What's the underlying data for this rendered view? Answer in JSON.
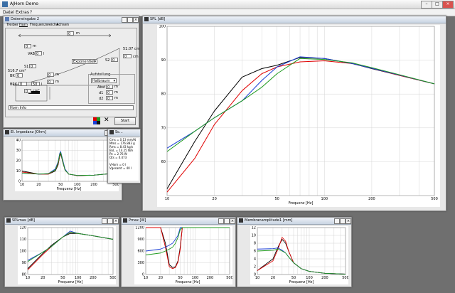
{
  "app": {
    "title": "AJHorn Demo"
  },
  "menu": {
    "items": [
      "Datei",
      "Extras",
      "?"
    ]
  },
  "colors": {
    "black": "#000000",
    "red": "#e00000",
    "blue": "#1a3ed6",
    "green": "#1f9a1f"
  },
  "input_window": {
    "title": "Dateneingabe 2",
    "tabs": [
      "Treiber",
      "Horn",
      "Frequenzweiche",
      "Achsen"
    ],
    "fields": {
      "length": "0",
      "vab": "0",
      "st": "0",
      "s2": "0",
      "s1": "0",
      "bk": "0",
      "x": "0",
      "y": "0",
      "brk": "0",
      "w": "50",
      "z": "0",
      "r1": "0",
      "r2": "0",
      "abst": "0",
      "d1": "0",
      "d2": "0"
    },
    "units": {
      "m": "m",
      "l": "l",
      "cm": "cm",
      "cm2": "cm²"
    },
    "labels": {
      "vab": "VAB",
      "s1": "S1",
      "s2": "S2",
      "bk": "BK",
      "brk": "BRK",
      "length_val": "51.07 cm",
      "area_val": "516.7 cm²",
      "aufstellung": "Aufstellung",
      "abst": "Abst",
      "d1": "d1",
      "d2": "d2",
      "horninfo": "Horn Info"
    },
    "horn_type": "Exponentiell",
    "placement": "Halbraum",
    "start_label": "Start"
  },
  "impedance_window": {
    "title": "El. Impedanz [Ohm]",
    "x_label": "Frequenz [Hz]",
    "x_ticks": [
      "10",
      "20",
      "50",
      "100",
      "200",
      "500"
    ],
    "y_ticks": [
      "40",
      "30",
      "20",
      "10",
      "0"
    ]
  },
  "params_window": {
    "title": "Sc...",
    "lines": [
      "Cms = 0.13 mm/N",
      "Mms = 176.883 g",
      "Rms = 8.43 kg/s",
      "BxL = 14.25 N/A",
      "Pe = 2.76 W",
      "Qts = 0.473",
      "",
      "VHorn = 0 l",
      "Vgesamt = 40 l"
    ]
  },
  "spl_window": {
    "title": "SPL [dB]",
    "x_label": "Frequenz [Hz]",
    "x_ticks": [
      "10",
      "20",
      "50",
      "100",
      "200",
      "500"
    ],
    "y_ticks": [
      "100",
      "90",
      "80",
      "70",
      "60"
    ]
  },
  "splmax_window": {
    "title": "SPLmax [dB]",
    "x_label": "Frequenz [Hz]",
    "x_ticks": [
      "10",
      "20",
      "50",
      "100",
      "200",
      "500"
    ],
    "y_ticks": [
      "120",
      "110",
      "100",
      "90",
      "80"
    ]
  },
  "pmax_window": {
    "title": "Pmax [W]",
    "x_label": "Frequenz [Hz]",
    "x_ticks": [
      "10",
      "20",
      "50",
      "100",
      "200",
      "500"
    ],
    "y_ticks": [
      "1200",
      "900",
      "600",
      "300",
      "0"
    ]
  },
  "membrane_window": {
    "title": "Membranamplitude1 [mm]",
    "x_label": "Frequenz [Hz]",
    "x_ticks": [
      "10",
      "20",
      "50",
      "100",
      "200",
      "500"
    ],
    "y_ticks": [
      "12",
      "10",
      "8",
      "6",
      "4",
      "2",
      "0"
    ]
  },
  "chart_data": [
    {
      "type": "line",
      "title": "SPL [dB]",
      "xlabel": "Frequenz [Hz]",
      "xscale": "log",
      "xlim": [
        10,
        500
      ],
      "ylim": [
        50,
        100
      ],
      "series": [
        {
          "color": "#000000",
          "x": [
            10,
            15,
            20,
            30,
            40,
            50,
            70,
            100,
            150,
            200,
            300,
            500
          ],
          "y": [
            52,
            66,
            75,
            85,
            87.5,
            88.5,
            90.8,
            90.5,
            89,
            87.5,
            85.5,
            83
          ]
        },
        {
          "color": "#e00000",
          "x": [
            10,
            15,
            20,
            30,
            40,
            50,
            70,
            100,
            150,
            200,
            300,
            500
          ],
          "y": [
            51,
            61,
            71,
            81,
            86,
            88,
            89.5,
            89.8,
            89,
            87.6,
            85.5,
            83
          ]
        },
        {
          "color": "#1a3ed6",
          "x": [
            10,
            15,
            20,
            30,
            40,
            50,
            70,
            100,
            150,
            200,
            300,
            500
          ],
          "y": [
            64,
            69,
            73,
            78,
            84,
            88,
            91,
            90.5,
            89,
            87.6,
            85.6,
            83
          ]
        },
        {
          "color": "#1f9a1f",
          "x": [
            10,
            15,
            20,
            30,
            40,
            50,
            70,
            100,
            150,
            200,
            300,
            500
          ],
          "y": [
            63,
            69,
            73,
            78,
            82,
            86,
            90.5,
            90.2,
            89.2,
            87.8,
            85.7,
            83
          ]
        }
      ]
    },
    {
      "type": "line",
      "title": "El. Impedanz [Ohm]",
      "xlabel": "Frequenz [Hz]",
      "xscale": "log",
      "xlim": [
        10,
        500
      ],
      "ylim": [
        0,
        40
      ],
      "series": [
        {
          "color": "#000000",
          "x": [
            10,
            20,
            30,
            40,
            45,
            48,
            50,
            55,
            60,
            70,
            100,
            200,
            500
          ],
          "y": [
            10,
            7,
            7,
            10,
            16,
            24,
            27,
            18,
            11,
            7,
            5.5,
            6,
            8
          ]
        },
        {
          "color": "#e00000",
          "x": [
            10,
            20,
            30,
            40,
            45,
            48,
            50,
            55,
            60,
            70,
            100,
            200,
            500
          ],
          "y": [
            9,
            7,
            7,
            11,
            17,
            25,
            28,
            19,
            11,
            7,
            5.6,
            6,
            8
          ]
        },
        {
          "color": "#1a3ed6",
          "x": [
            10,
            20,
            30,
            40,
            45,
            48,
            50,
            55,
            60,
            70,
            100,
            200,
            500
          ],
          "y": [
            8,
            7,
            7.5,
            12,
            19,
            27,
            29,
            20,
            12,
            7,
            5.7,
            6,
            8
          ]
        },
        {
          "color": "#1f9a1f",
          "x": [
            10,
            20,
            30,
            40,
            45,
            48,
            50,
            55,
            60,
            70,
            100,
            200,
            500
          ],
          "y": [
            8,
            7,
            7.5,
            11,
            18,
            26,
            28,
            19,
            11,
            7,
            5.7,
            6,
            8
          ]
        }
      ]
    },
    {
      "type": "line",
      "title": "SPLmax [dB]",
      "xlabel": "Frequenz [Hz]",
      "xscale": "log",
      "xlim": [
        10,
        500
      ],
      "ylim": [
        80,
        120
      ],
      "series": [
        {
          "color": "#000000",
          "x": [
            10,
            20,
            30,
            50,
            70,
            100,
            200,
            500
          ],
          "y": [
            85,
            98,
            105,
            112,
            115,
            115,
            113,
            110
          ]
        },
        {
          "color": "#e00000",
          "x": [
            10,
            20,
            30,
            50,
            70,
            100,
            200,
            500
          ],
          "y": [
            84,
            97,
            104,
            112,
            116,
            115,
            113,
            110
          ]
        },
        {
          "color": "#1a3ed6",
          "x": [
            10,
            20,
            30,
            50,
            70,
            100,
            200,
            500
          ],
          "y": [
            92,
            99,
            104,
            112,
            117,
            115,
            113,
            110
          ]
        },
        {
          "color": "#1f9a1f",
          "x": [
            10,
            20,
            30,
            50,
            70,
            100,
            200,
            500
          ],
          "y": [
            91,
            99,
            104,
            112,
            116,
            115,
            113,
            110
          ]
        }
      ]
    },
    {
      "type": "line",
      "title": "Pmax [W]",
      "xlabel": "Frequenz [Hz]",
      "xscale": "log",
      "xlim": [
        10,
        500
      ],
      "ylim": [
        0,
        1200
      ],
      "series": [
        {
          "color": "#000000",
          "x": [
            10,
            20,
            25,
            30,
            35,
            40,
            45,
            50,
            55,
            100,
            500
          ],
          "y": [
            1200,
            1200,
            800,
            250,
            180,
            200,
            350,
            700,
            1200,
            1200,
            1200
          ]
        },
        {
          "color": "#e00000",
          "x": [
            10,
            20,
            25,
            30,
            35,
            40,
            45,
            50,
            55,
            100,
            500
          ],
          "y": [
            1200,
            1200,
            700,
            200,
            150,
            180,
            320,
            650,
            1200,
            1200,
            1200
          ]
        },
        {
          "color": "#1a3ed6",
          "x": [
            10,
            20,
            25,
            30,
            35,
            40,
            45,
            50,
            55,
            100,
            500
          ],
          "y": [
            600,
            650,
            700,
            750,
            800,
            900,
            1000,
            1200,
            1200,
            1200,
            1200
          ]
        },
        {
          "color": "#1f9a1f",
          "x": [
            10,
            20,
            25,
            30,
            35,
            40,
            45,
            50,
            55,
            100,
            500
          ],
          "y": [
            500,
            550,
            600,
            650,
            700,
            800,
            950,
            1150,
            1200,
            1200,
            1200
          ]
        }
      ]
    },
    {
      "type": "line",
      "title": "Membranamplitude1 [mm]",
      "xlabel": "Frequenz [Hz]",
      "xscale": "log",
      "xlim": [
        10,
        500
      ],
      "ylim": [
        0,
        12
      ],
      "series": [
        {
          "color": "#000000",
          "x": [
            10,
            20,
            25,
            30,
            35,
            40,
            50,
            70,
            100,
            200,
            500
          ],
          "y": [
            1,
            4,
            7,
            9,
            8,
            6,
            3,
            1.5,
            0.8,
            0.3,
            0.1
          ]
        },
        {
          "color": "#e00000",
          "x": [
            10,
            20,
            25,
            30,
            35,
            40,
            50,
            70,
            100,
            200,
            500
          ],
          "y": [
            1,
            3.5,
            6.5,
            9.5,
            8.5,
            6,
            3,
            1.5,
            0.8,
            0.3,
            0.1
          ]
        },
        {
          "color": "#1a3ed6",
          "x": [
            10,
            20,
            25,
            30,
            35,
            40,
            50,
            70,
            100,
            200,
            500
          ],
          "y": [
            6.5,
            6.6,
            6.8,
            6.2,
            5.5,
            4.5,
            3,
            1.5,
            0.8,
            0.3,
            0.1
          ]
        },
        {
          "color": "#1f9a1f",
          "x": [
            10,
            20,
            25,
            30,
            35,
            40,
            50,
            70,
            100,
            200,
            500
          ],
          "y": [
            6,
            6.2,
            6.5,
            6,
            5.5,
            4.5,
            3,
            1.5,
            0.8,
            0.3,
            0.1
          ]
        }
      ]
    }
  ]
}
